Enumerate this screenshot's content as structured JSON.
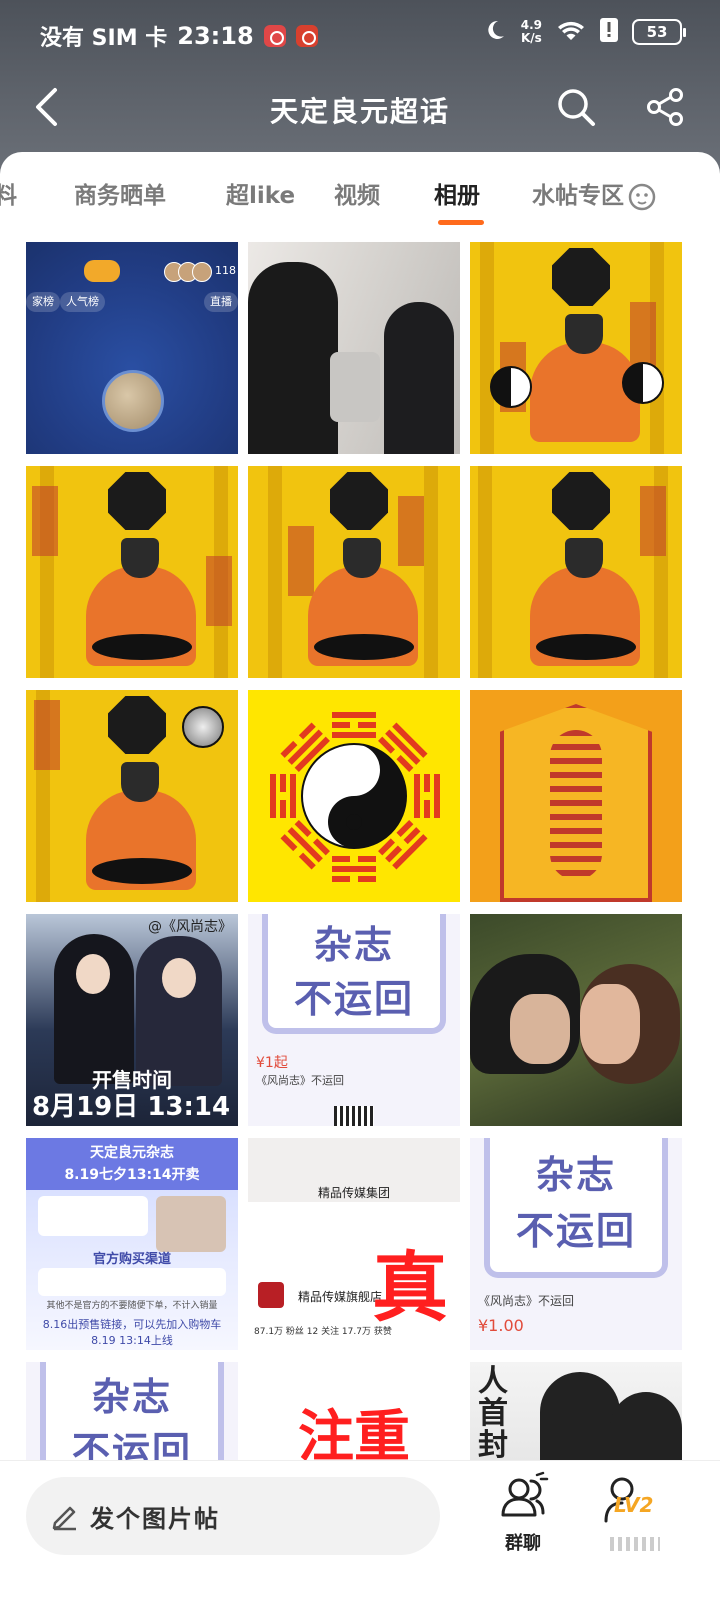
{
  "status_bar": {
    "carrier": "没有 SIM 卡",
    "time": "23:18",
    "net_speed_value": "4.9",
    "net_speed_unit": "K/s",
    "battery": "53"
  },
  "header": {
    "title": "天定良元超话"
  },
  "tabs": [
    {
      "label": "料"
    },
    {
      "label": "商务晒单"
    },
    {
      "label": "超like"
    },
    {
      "label": "视频"
    },
    {
      "label": "相册",
      "active": true
    },
    {
      "label": "水帖专区"
    }
  ],
  "tiles": {
    "game": {
      "pill1": "家榜",
      "pill2": "人气榜",
      "pill3": "直播",
      "count": "118"
    },
    "poster": {
      "mag": "@《风尚志》",
      "sale": "开售时间",
      "date": "8月19日 13:14"
    },
    "magazine": {
      "big1": "杂志",
      "big2": "不运回",
      "price": "¥1起",
      "caption": "《风尚志》不运回"
    },
    "infographic": {
      "head1": "天定良元杂志",
      "head2": "8.19七夕13:14开卖",
      "channel": "官方购买渠道",
      "note": "其他不是官方的不要随便下单，不计入销量",
      "preorder": "8.16出预售链接，可以先加入购物车",
      "launch": "8.19 13:14上线"
    },
    "shop": {
      "group": "精品传媒集团",
      "store": "精品传媒旗舰店",
      "big": "真",
      "stats": "87.1万 粉丝 12 关注 17.7万 获赞"
    },
    "magazine2": {
      "big1": "杂志",
      "big2": "不运回",
      "caption": "《风尚志》不运回",
      "price": "¥1.00"
    },
    "magazine3": {
      "big1": "杂志",
      "big2": "不运回"
    },
    "note": {
      "big": "注重"
    },
    "poster2": {
      "txt1": "人",
      "txt2": "首",
      "txt3": "封"
    }
  },
  "bottom": {
    "post_label": "发个图片帖",
    "group_chat_label": "群聊",
    "level": "LV2"
  },
  "colors": {
    "accent": "#ff6a1c",
    "header_bg": "#5a5f67",
    "level": "#f5a623"
  }
}
